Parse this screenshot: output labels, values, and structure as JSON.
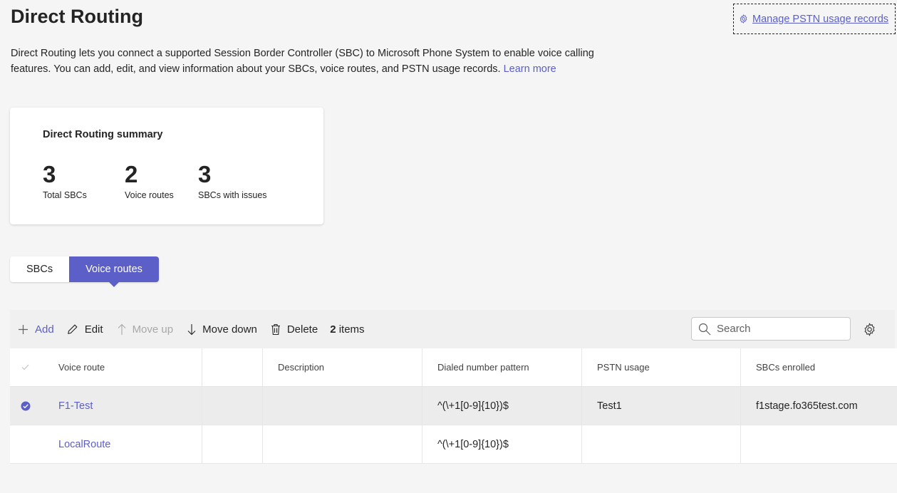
{
  "page": {
    "title": "Direct Routing",
    "manage_link": "Manage PSTN usage records",
    "intro_text": "Direct Routing lets you connect a supported Session Border Controller (SBC) to Microsoft Phone System to enable voice calling features. You can add, edit, and view information about your SBCs, voice routes, and PSTN usage records.",
    "learn_more": "Learn more"
  },
  "summary": {
    "title": "Direct Routing summary",
    "stats": [
      {
        "value": "3",
        "label": "Total SBCs"
      },
      {
        "value": "2",
        "label": "Voice routes"
      },
      {
        "value": "3",
        "label": "SBCs with issues"
      }
    ]
  },
  "tabs": [
    {
      "label": "SBCs",
      "active": false
    },
    {
      "label": "Voice routes",
      "active": true
    }
  ],
  "toolbar": {
    "add": "Add",
    "edit": "Edit",
    "move_up": "Move up",
    "move_down": "Move down",
    "delete": "Delete",
    "item_count": "2",
    "item_count_suffix": "items",
    "search_placeholder": "Search"
  },
  "table": {
    "columns": [
      "Voice route",
      "Description",
      "Dialed number pattern",
      "PSTN usage",
      "SBCs enrolled"
    ],
    "rows": [
      {
        "voice_route": "F1-Test",
        "description": "",
        "pattern": "^(\\+1[0-9]{10})$",
        "pstn_usage": "Test1",
        "sbcs": "f1stage.fo365test.com",
        "selected": true
      },
      {
        "voice_route": "LocalRoute",
        "description": "",
        "pattern": "^(\\+1[0-9]{10})$",
        "pstn_usage": "",
        "sbcs": "",
        "selected": false
      }
    ]
  },
  "colors": {
    "accent": "#5b5fc7",
    "background": "#f5f5f5",
    "disabled": "#a8a8a8"
  }
}
